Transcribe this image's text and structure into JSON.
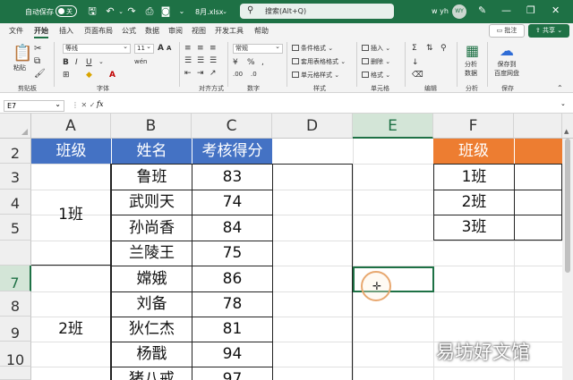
{
  "titlebar": {
    "autosave_label": "自动保存",
    "autosave_state": "关",
    "file_name": "8月.xlsx",
    "search_placeholder": "搜索(Alt+Q)",
    "user_name": "w yh",
    "user_initials": "WY",
    "accent_color": "#1e7145"
  },
  "menu": {
    "tabs": [
      "文件",
      "开始",
      "插入",
      "页面布局",
      "公式",
      "数据",
      "审阅",
      "视图",
      "开发工具",
      "帮助"
    ],
    "active_tab": "开始",
    "comment_button": "批注",
    "share_button": "共享"
  },
  "ribbon": {
    "paste": "粘贴",
    "clipboard": "剪贴板",
    "font_name": "等线",
    "font_size": "11",
    "font_group": "字体",
    "align_group": "对齐方式",
    "number_format": "常规",
    "number_group": "数字",
    "cond_format": "条件格式",
    "table_format": "套用表格格式",
    "cell_style": "单元格样式",
    "styles_group": "样式",
    "insert": "插入",
    "delete": "删除",
    "format": "格式",
    "cells_group": "单元格",
    "editing_group": "编辑",
    "analyze_data": "分析数据",
    "analyze_line1": "分析",
    "analyze_line2": "数据",
    "analysis_group": "分析",
    "save_to_cloud_line1": "保存到",
    "save_to_cloud_line2": "百度网盘",
    "save_group": "保存"
  },
  "formula_bar": {
    "name_box": "E7",
    "fx_label": "fx",
    "formula": ""
  },
  "sheet": {
    "columns": [
      "A",
      "B",
      "C",
      "D",
      "E",
      "F"
    ],
    "rows": [
      "2",
      "3",
      "4",
      "5",
      "7",
      "8",
      "9",
      "10"
    ],
    "selected_cell": "E7",
    "table1": {
      "headers": [
        "班级",
        "姓名",
        "考核得分"
      ],
      "groups": [
        {
          "class": "1班",
          "rows": [
            {
              "name": "鲁班",
              "score": "83"
            },
            {
              "name": "武则天",
              "score": "74"
            },
            {
              "name": "孙尚香",
              "score": "84"
            },
            {
              "name": "兰陵王",
              "score": "75"
            }
          ]
        },
        {
          "class": "2班",
          "rows": [
            {
              "name": "嫦娥",
              "score": "86"
            },
            {
              "name": "刘备",
              "score": "78"
            },
            {
              "name": "狄仁杰",
              "score": "81"
            },
            {
              "name": "杨戬",
              "score": "94"
            },
            {
              "name": "猪八戒",
              "score": "97"
            }
          ]
        }
      ]
    },
    "table2": {
      "header": "班级",
      "values": [
        "1班",
        "2班",
        "3班"
      ]
    },
    "header_blue": "#4472c4",
    "header_orange": "#ed7d31"
  },
  "watermark": "易坊好文馆"
}
